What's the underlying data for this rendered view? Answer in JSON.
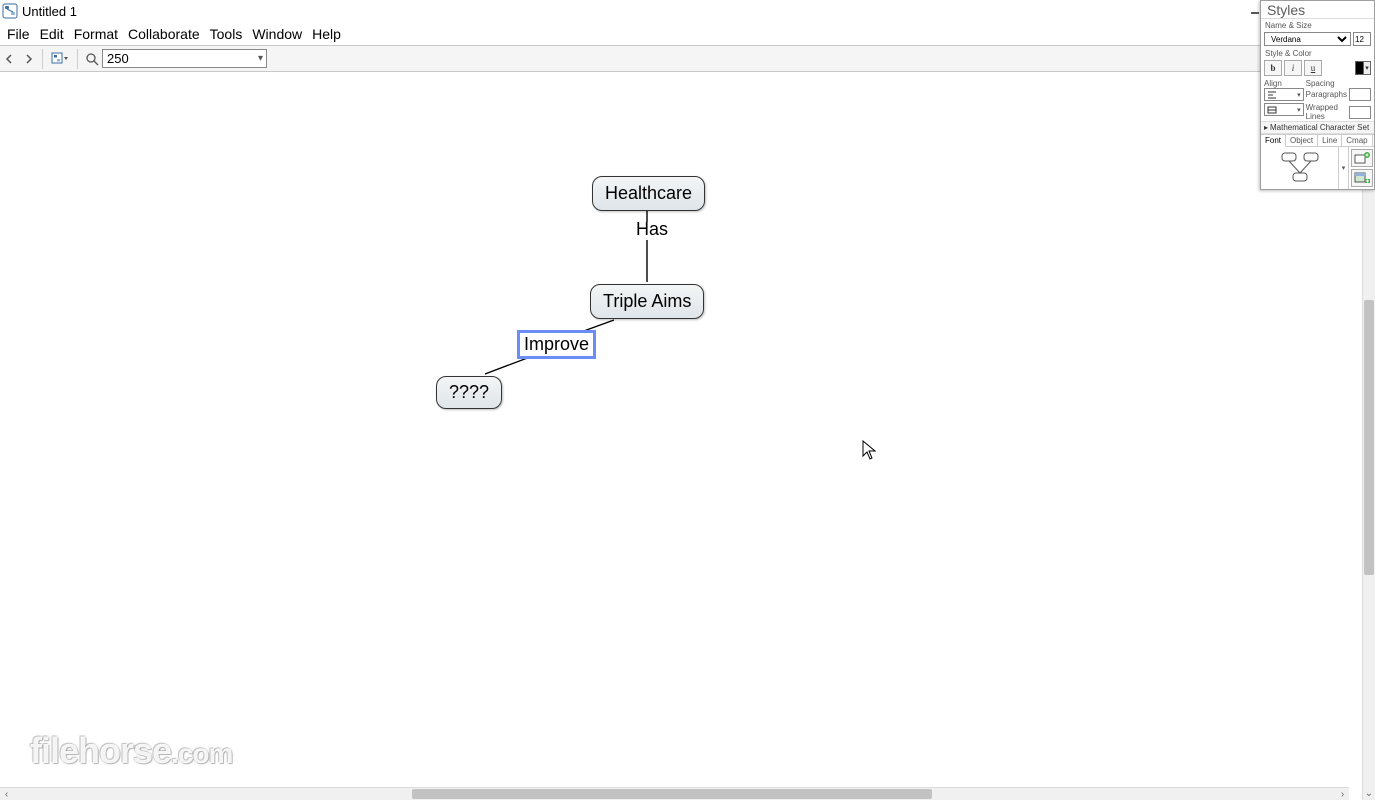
{
  "window": {
    "title": "Untitled 1"
  },
  "menu": {
    "file": "File",
    "edit": "Edit",
    "format": "Format",
    "collaborate": "Collaborate",
    "tools": "Tools",
    "window": "Window",
    "help": "Help"
  },
  "toolbar": {
    "zoom_value": "250"
  },
  "nodes": {
    "healthcare": "Healthcare",
    "triple_aims": "Triple Aims",
    "unknown": "????"
  },
  "links": {
    "has": "Has",
    "improve": "Improve"
  },
  "styles_panel": {
    "title": "Styles",
    "sections": {
      "name_size": "Name & Size",
      "style_color": "Style & Color",
      "align": "Align",
      "spacing": "Spacing",
      "paragraphs": "Paragraphs",
      "wrapped_lines": "Wrapped Lines",
      "mathset": "Mathematical Character Set"
    },
    "font_name": "Verdana",
    "font_size": "12",
    "bold": "b",
    "italic": "i",
    "underline": "u",
    "tabs": {
      "font": "Font",
      "object": "Object",
      "line": "Line",
      "cmap": "Cmap"
    }
  },
  "watermark": {
    "brand": "filehorse",
    "tld": ".com"
  }
}
